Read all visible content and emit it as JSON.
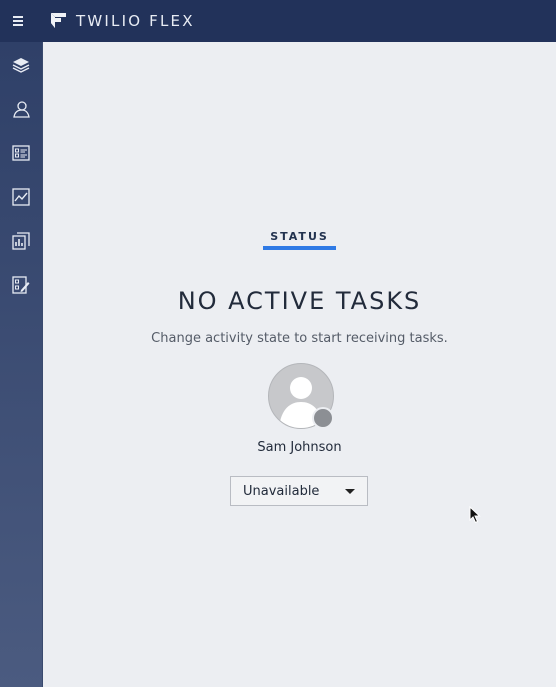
{
  "topbar": {
    "brand": "TWILIO FLEX",
    "menu_icon": "hamburger-icon",
    "logo_icon": "twilio-flex-logo-icon"
  },
  "sidebar": {
    "items": [
      {
        "name": "layers-icon"
      },
      {
        "name": "contact-icon"
      },
      {
        "name": "task-list-icon"
      },
      {
        "name": "trend-chart-icon"
      },
      {
        "name": "reports-icon"
      },
      {
        "name": "edit-checklist-icon"
      }
    ]
  },
  "main": {
    "tab_label": "STATUS",
    "title": "NO ACTIVE TASKS",
    "subtitle": "Change activity state to start receiving tasks.",
    "agent_name": "Sam Johnson",
    "activity_selected": "Unavailable"
  },
  "colors": {
    "topbar": "#22325a",
    "accent": "#2f7ae5",
    "presence_offline": "#8c8f94"
  }
}
